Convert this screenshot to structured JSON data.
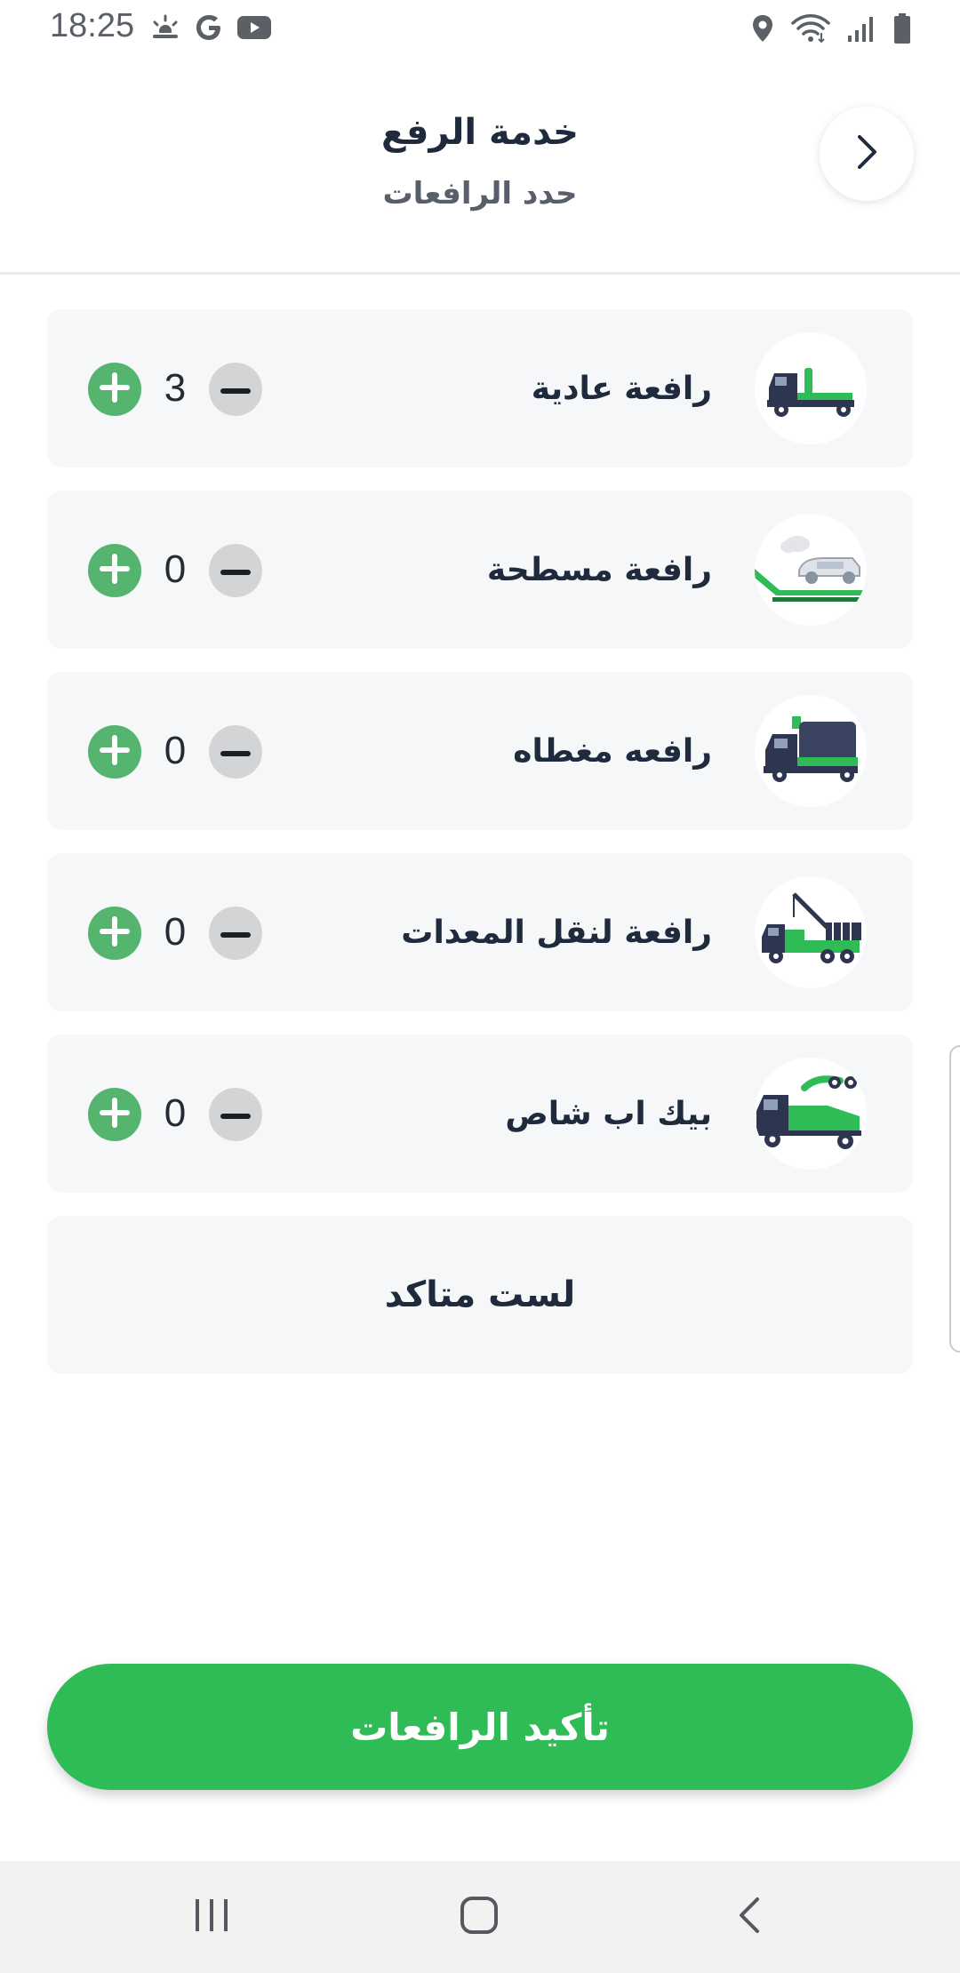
{
  "status_bar": {
    "time": "18:25",
    "left_icons": [
      "weather-sunrise-icon",
      "google-icon",
      "youtube-icon"
    ],
    "right_icons": [
      "location-icon",
      "wifi-icon",
      "signal-icon",
      "battery-icon"
    ]
  },
  "header": {
    "title": "خدمة الرفع",
    "subtitle": "حدد الرافعات",
    "back_icon": "chevron-right-icon"
  },
  "tow_types": [
    {
      "label": "رافعة عادية",
      "quantity": "3",
      "icon": "regular-tow-truck-icon"
    },
    {
      "label": "رافعة مسطحة",
      "quantity": "0",
      "icon": "flatbed-tow-truck-icon"
    },
    {
      "label": "رافعه مغطاه",
      "quantity": "0",
      "icon": "covered-tow-truck-icon"
    },
    {
      "label": "رافعة لنقل المعدات",
      "quantity": "0",
      "icon": "equipment-crane-truck-icon"
    },
    {
      "label": "بيك اب شاص",
      "quantity": "0",
      "icon": "pickup-chassis-truck-icon"
    }
  ],
  "unsure": {
    "label": "لست متاكد"
  },
  "confirm": {
    "label": "تأكيد الرافعات"
  },
  "nav_bar": {
    "icons": [
      "recent-apps-icon",
      "home-icon",
      "back-icon"
    ]
  },
  "colors": {
    "accent_green": "#2fbb55",
    "plus_green": "#55b56f",
    "minus_gray": "#d3d4d6",
    "card_bg": "#f6f7f9",
    "text_dark": "#1f2a3d",
    "truck_navy": "#2d3550"
  }
}
